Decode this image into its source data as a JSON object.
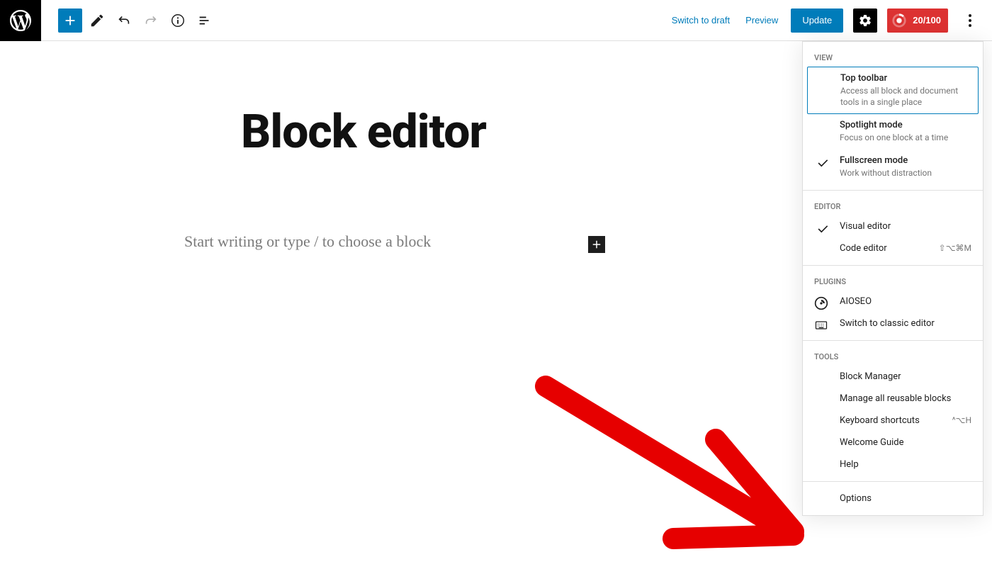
{
  "header": {
    "switch_draft": "Switch to draft",
    "preview": "Preview",
    "update": "Update",
    "seo_score": "20/100"
  },
  "editor": {
    "title": "Block editor",
    "placeholder": "Start writing or type / to choose a block"
  },
  "dropdown": {
    "sections": {
      "view": {
        "heading": "View",
        "items": [
          {
            "label": "Top toolbar",
            "desc": "Access all block and document tools in a single place",
            "selected": true
          },
          {
            "label": "Spotlight mode",
            "desc": "Focus on one block at a time"
          },
          {
            "label": "Fullscreen mode",
            "desc": "Work without distraction",
            "checked": true
          }
        ]
      },
      "editor": {
        "heading": "Editor",
        "items": [
          {
            "label": "Visual editor",
            "checked": true
          },
          {
            "label": "Code editor",
            "shortcut": "⇧⌥⌘M"
          }
        ]
      },
      "plugins": {
        "heading": "Plugins",
        "items": [
          {
            "label": "AIOSEO",
            "icon": "aioseo"
          },
          {
            "label": "Switch to classic editor",
            "icon": "keyboard"
          }
        ]
      },
      "tools": {
        "heading": "Tools",
        "items": [
          {
            "label": "Block Manager"
          },
          {
            "label": "Manage all reusable blocks"
          },
          {
            "label": "Keyboard shortcuts",
            "shortcut": "^⌥H"
          },
          {
            "label": "Welcome Guide"
          },
          {
            "label": "Help"
          }
        ]
      },
      "options": {
        "items": [
          {
            "label": "Options"
          }
        ]
      }
    }
  }
}
